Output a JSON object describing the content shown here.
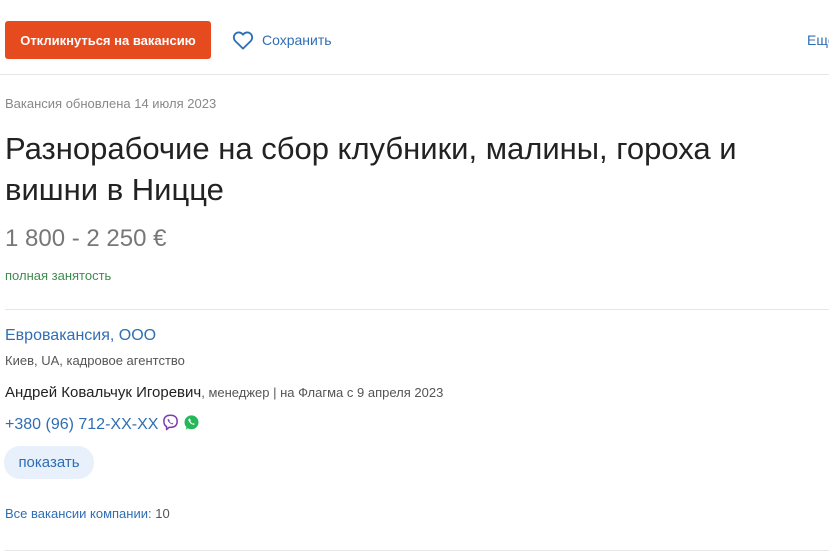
{
  "actions": {
    "apply_label": "Откликнуться на вакансию",
    "save_label": "Сохранить",
    "more_label": "Ещё"
  },
  "vacancy": {
    "updated": "Вакансия обновлена 14 июля 2023",
    "title": "Разнорабочие на сбор клубники, малины, гороха и вишни в Ницце",
    "salary": "1 800 - 2 250 €",
    "employment": "полная занятость"
  },
  "company": {
    "name": "Евровакансия, ООО",
    "meta": "Киев, UA, кадровое агентство",
    "contact_name": "Андрей Ковальчук Игоревич",
    "contact_role": ", менеджер | на Флагма с 9 апреля 2023",
    "phone": "+380 (96) 712-XX-XX",
    "show_label": "показать",
    "all_vacancies_label": "Все вакансии компании:",
    "all_vacancies_count": "10"
  },
  "icons": {
    "save": "heart-outline-icon",
    "viber": "viber-icon",
    "whatsapp": "whatsapp-icon"
  },
  "colors": {
    "accent": "#e64a1f",
    "link": "#2f6eb5",
    "employment": "#3f8b4f",
    "viber": "#7d3daf",
    "whatsapp": "#25b85a"
  }
}
